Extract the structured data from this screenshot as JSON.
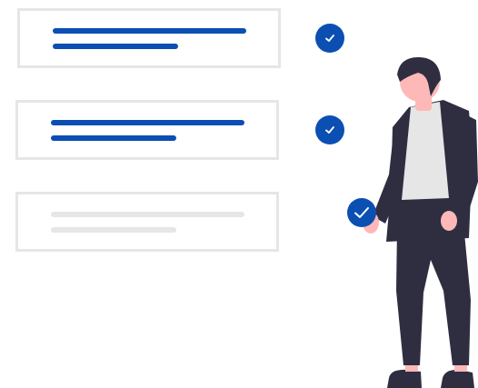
{
  "colors": {
    "accent": "#0b4fb3",
    "card_border": "#e6e6e6",
    "placeholder_bar": "#e6e6e6",
    "suit": "#2f2e41",
    "shirt": "#e6e6e6",
    "skin": "#ffb8b8",
    "hair": "#2f2e41",
    "check_mark": "#ffffff"
  },
  "checklist": {
    "items": [
      {
        "state": "completed",
        "icon": "check-icon"
      },
      {
        "state": "completed",
        "icon": "check-icon"
      },
      {
        "state": "pending",
        "icon": "none"
      }
    ]
  },
  "illustration": {
    "subject": "standing-person",
    "held_item": "check-icon"
  }
}
